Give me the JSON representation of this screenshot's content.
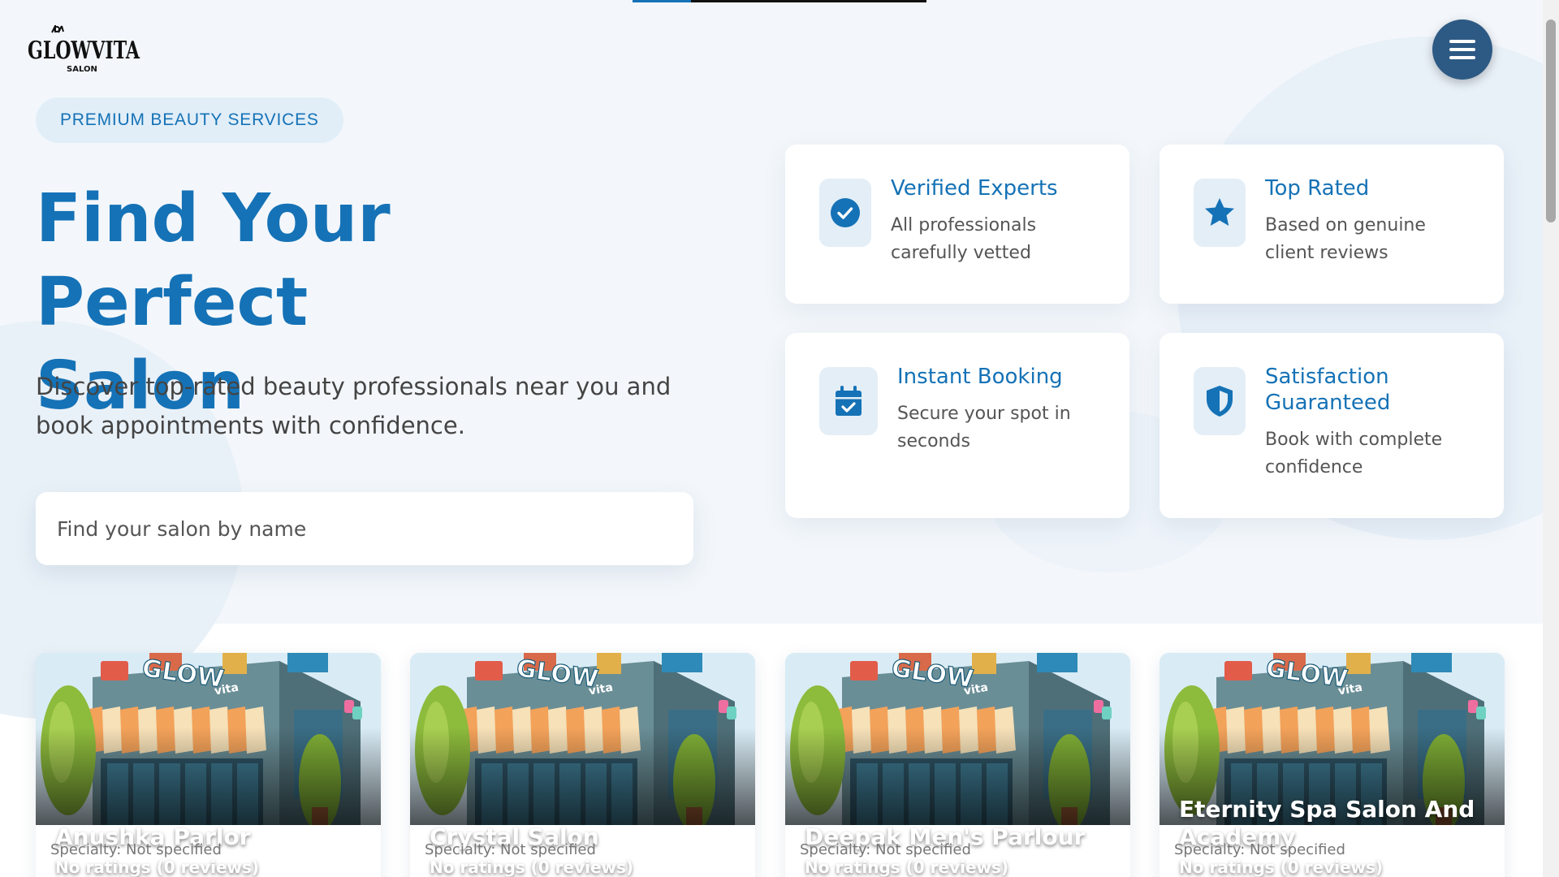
{
  "brand": {
    "logo_text": "GLOWVITA",
    "logo_subtext": "SALON"
  },
  "hero": {
    "badge": "PREMIUM BEAUTY SERVICES",
    "title_line1": "Find Your Perfect",
    "title_line2": "Salon",
    "subtitle": "Discover top-rated beauty professionals near you and book appointments with confidence.",
    "search_placeholder": "Find your salon by name",
    "search_value": ""
  },
  "features": [
    {
      "title": "Verified Experts",
      "desc": "All professionals carefully vetted",
      "icon": "check-circle-icon"
    },
    {
      "title": "Top Rated",
      "desc": "Based on genuine client reviews",
      "icon": "star-icon"
    },
    {
      "title": "Instant Booking",
      "desc": "Secure your spot in seconds",
      "icon": "calendar-check-icon"
    },
    {
      "title": "Satisfaction Guaranteed",
      "desc": "Book with complete confidence",
      "icon": "shield-icon"
    }
  ],
  "salons": [
    {
      "name": "Anushka Parlor",
      "rating": "No ratings (0 reviews)",
      "specialty": "Specialty: Not specified"
    },
    {
      "name": "Crystal Salon",
      "rating": "No ratings (0 reviews)",
      "specialty": "Specialty: Not specified"
    },
    {
      "name": "Deepak Men's Parlour",
      "rating": "No ratings (0 reviews)",
      "specialty": "Specialty: Not specified"
    },
    {
      "name": "Eternity Spa Salon And Academy",
      "rating": "No ratings (0 reviews)",
      "specialty": "Specialty: Not specified"
    }
  ],
  "salon_image_sign": "GLOW",
  "salon_image_sign_small": "vita",
  "colors": {
    "primary": "#1572b6",
    "menu_button": "#2d5a84",
    "icon_bg": "#e3eef7",
    "hero_bg": "#f3f7fb"
  },
  "top_progress": 0.2
}
